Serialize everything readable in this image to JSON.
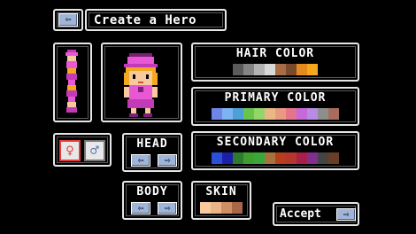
{
  "header": {
    "title": "Create a Hero",
    "back_icon": "arrow-left-icon"
  },
  "gender": {
    "female_symbol": "♀",
    "male_symbol": "♂",
    "female_color": "#e63c3c",
    "male_color": "#6a82b8"
  },
  "head": {
    "label": "HEAD",
    "prev": "⇦",
    "next": "⇨"
  },
  "body_part": {
    "label": "BODY",
    "prev": "⇦",
    "next": "⇨"
  },
  "hair_color": {
    "label": "HAIR COLOR",
    "swatches": [
      "#5b5b5b",
      "#858585",
      "#b3b3b3",
      "#d8d8d8",
      "#a86d46",
      "#7a4a2c",
      "#e58a1c",
      "#f3a81e"
    ]
  },
  "primary_color": {
    "label": "PRIMARY COLOR",
    "swatches": [
      "#6f86e6",
      "#7cb3f2",
      "#4ca0d6",
      "#68c44a",
      "#93d76a",
      "#e9b884",
      "#ea9a80",
      "#e4748c",
      "#c66ad9",
      "#b98ce3",
      "#8e8e8e",
      "#a86d5a"
    ]
  },
  "secondary_color": {
    "label": "SECONDARY COLOR",
    "swatches": [
      "#2b4fd8",
      "#1c20a8",
      "#2e7a2e",
      "#3e9e2e",
      "#3aa63a",
      "#a8723e",
      "#b83d1c",
      "#b4362c",
      "#a8204a",
      "#822e8e",
      "#444444",
      "#6a3e24"
    ]
  },
  "skin": {
    "label": "SKIN",
    "swatches": [
      "#f7c99c",
      "#ebb486",
      "#d18e63",
      "#a9674a"
    ]
  },
  "accept": {
    "label": "Accept",
    "icon": "arrow-right-icon"
  }
}
